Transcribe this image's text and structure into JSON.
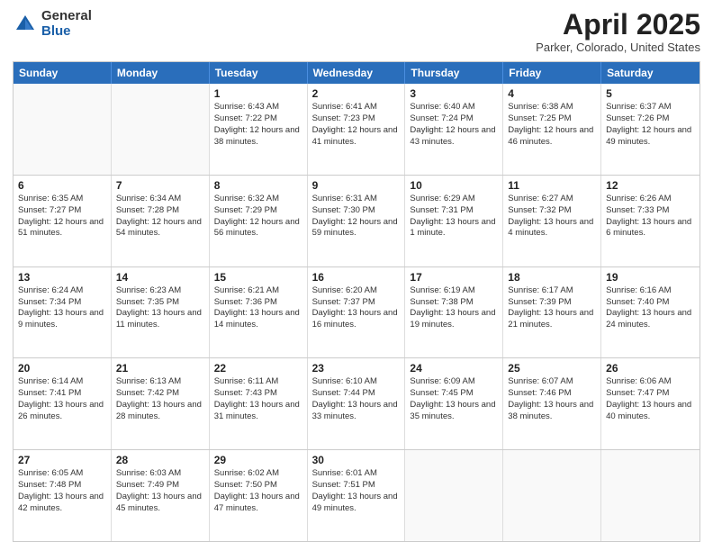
{
  "header": {
    "logo_general": "General",
    "logo_blue": "Blue",
    "title": "April 2025",
    "location": "Parker, Colorado, United States"
  },
  "weekdays": [
    "Sunday",
    "Monday",
    "Tuesday",
    "Wednesday",
    "Thursday",
    "Friday",
    "Saturday"
  ],
  "weeks": [
    [
      {
        "day": "",
        "info": "",
        "empty": true
      },
      {
        "day": "",
        "info": "",
        "empty": true
      },
      {
        "day": "1",
        "info": "Sunrise: 6:43 AM\nSunset: 7:22 PM\nDaylight: 12 hours and 38 minutes."
      },
      {
        "day": "2",
        "info": "Sunrise: 6:41 AM\nSunset: 7:23 PM\nDaylight: 12 hours and 41 minutes."
      },
      {
        "day": "3",
        "info": "Sunrise: 6:40 AM\nSunset: 7:24 PM\nDaylight: 12 hours and 43 minutes."
      },
      {
        "day": "4",
        "info": "Sunrise: 6:38 AM\nSunset: 7:25 PM\nDaylight: 12 hours and 46 minutes."
      },
      {
        "day": "5",
        "info": "Sunrise: 6:37 AM\nSunset: 7:26 PM\nDaylight: 12 hours and 49 minutes."
      }
    ],
    [
      {
        "day": "6",
        "info": "Sunrise: 6:35 AM\nSunset: 7:27 PM\nDaylight: 12 hours and 51 minutes."
      },
      {
        "day": "7",
        "info": "Sunrise: 6:34 AM\nSunset: 7:28 PM\nDaylight: 12 hours and 54 minutes."
      },
      {
        "day": "8",
        "info": "Sunrise: 6:32 AM\nSunset: 7:29 PM\nDaylight: 12 hours and 56 minutes."
      },
      {
        "day": "9",
        "info": "Sunrise: 6:31 AM\nSunset: 7:30 PM\nDaylight: 12 hours and 59 minutes."
      },
      {
        "day": "10",
        "info": "Sunrise: 6:29 AM\nSunset: 7:31 PM\nDaylight: 13 hours and 1 minute."
      },
      {
        "day": "11",
        "info": "Sunrise: 6:27 AM\nSunset: 7:32 PM\nDaylight: 13 hours and 4 minutes."
      },
      {
        "day": "12",
        "info": "Sunrise: 6:26 AM\nSunset: 7:33 PM\nDaylight: 13 hours and 6 minutes."
      }
    ],
    [
      {
        "day": "13",
        "info": "Sunrise: 6:24 AM\nSunset: 7:34 PM\nDaylight: 13 hours and 9 minutes."
      },
      {
        "day": "14",
        "info": "Sunrise: 6:23 AM\nSunset: 7:35 PM\nDaylight: 13 hours and 11 minutes."
      },
      {
        "day": "15",
        "info": "Sunrise: 6:21 AM\nSunset: 7:36 PM\nDaylight: 13 hours and 14 minutes."
      },
      {
        "day": "16",
        "info": "Sunrise: 6:20 AM\nSunset: 7:37 PM\nDaylight: 13 hours and 16 minutes."
      },
      {
        "day": "17",
        "info": "Sunrise: 6:19 AM\nSunset: 7:38 PM\nDaylight: 13 hours and 19 minutes."
      },
      {
        "day": "18",
        "info": "Sunrise: 6:17 AM\nSunset: 7:39 PM\nDaylight: 13 hours and 21 minutes."
      },
      {
        "day": "19",
        "info": "Sunrise: 6:16 AM\nSunset: 7:40 PM\nDaylight: 13 hours and 24 minutes."
      }
    ],
    [
      {
        "day": "20",
        "info": "Sunrise: 6:14 AM\nSunset: 7:41 PM\nDaylight: 13 hours and 26 minutes."
      },
      {
        "day": "21",
        "info": "Sunrise: 6:13 AM\nSunset: 7:42 PM\nDaylight: 13 hours and 28 minutes."
      },
      {
        "day": "22",
        "info": "Sunrise: 6:11 AM\nSunset: 7:43 PM\nDaylight: 13 hours and 31 minutes."
      },
      {
        "day": "23",
        "info": "Sunrise: 6:10 AM\nSunset: 7:44 PM\nDaylight: 13 hours and 33 minutes."
      },
      {
        "day": "24",
        "info": "Sunrise: 6:09 AM\nSunset: 7:45 PM\nDaylight: 13 hours and 35 minutes."
      },
      {
        "day": "25",
        "info": "Sunrise: 6:07 AM\nSunset: 7:46 PM\nDaylight: 13 hours and 38 minutes."
      },
      {
        "day": "26",
        "info": "Sunrise: 6:06 AM\nSunset: 7:47 PM\nDaylight: 13 hours and 40 minutes."
      }
    ],
    [
      {
        "day": "27",
        "info": "Sunrise: 6:05 AM\nSunset: 7:48 PM\nDaylight: 13 hours and 42 minutes."
      },
      {
        "day": "28",
        "info": "Sunrise: 6:03 AM\nSunset: 7:49 PM\nDaylight: 13 hours and 45 minutes."
      },
      {
        "day": "29",
        "info": "Sunrise: 6:02 AM\nSunset: 7:50 PM\nDaylight: 13 hours and 47 minutes."
      },
      {
        "day": "30",
        "info": "Sunrise: 6:01 AM\nSunset: 7:51 PM\nDaylight: 13 hours and 49 minutes."
      },
      {
        "day": "",
        "info": "",
        "empty": true
      },
      {
        "day": "",
        "info": "",
        "empty": true
      },
      {
        "day": "",
        "info": "",
        "empty": true
      }
    ]
  ]
}
